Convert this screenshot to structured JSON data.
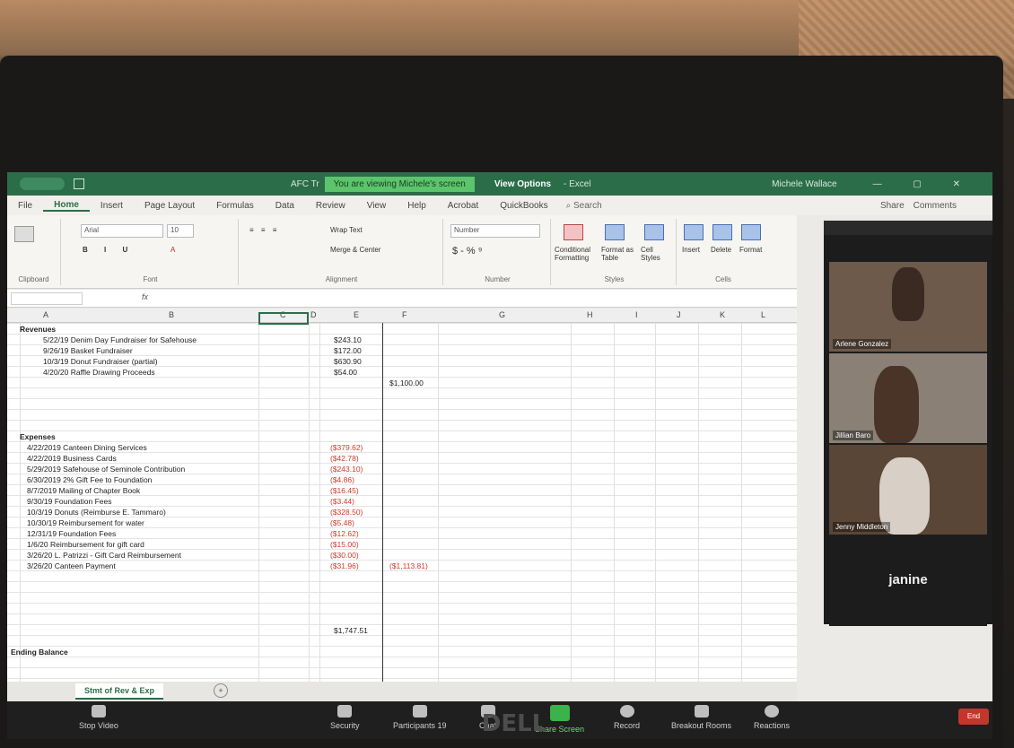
{
  "excel": {
    "doc_title": "AFC Tr",
    "viewing_banner": "You are viewing Michele's screen",
    "view_options": "View Options",
    "excel_suffix": "- Excel",
    "user_name": "Michele Wallace",
    "tabs": [
      "File",
      "Home",
      "Insert",
      "Page Layout",
      "Formulas",
      "Data",
      "Review",
      "View",
      "Help",
      "Acrobat",
      "QuickBooks"
    ],
    "search": "Search",
    "share": "Share",
    "comments": "Comments",
    "ribbon": {
      "font_name": "Arial",
      "font_size": "10",
      "wrap_text": "Wrap Text",
      "merge_center": "Merge & Center",
      "number_format": "Number",
      "conditional_formatting": "Conditional Formatting",
      "format_as_table": "Format as Table",
      "cell_styles": "Cell Styles",
      "insert": "Insert",
      "delete": "Delete",
      "format": "Format",
      "groups": [
        "Clipboard",
        "Font",
        "Alignment",
        "Number",
        "Styles",
        "Cells"
      ]
    },
    "columns": [
      "A",
      "B",
      "C",
      "D",
      "E",
      "F",
      "G",
      "H",
      "I",
      "J",
      "K",
      "L"
    ],
    "revenues_header": "Revenues",
    "revenues": [
      {
        "desc": "5/22/19 Denim Day Fundraiser for Safehouse",
        "amount": "$243.10"
      },
      {
        "desc": "9/26/19 Basket Fundraiser",
        "amount": "$172.00"
      },
      {
        "desc": "10/3/19 Donut Fundraiser (partial)",
        "amount": "$630.90"
      },
      {
        "desc": "4/20/20 Raffle Drawing Proceeds",
        "amount": "$54.00"
      }
    ],
    "revenue_total": "$1,100.00",
    "expenses_header": "Expenses",
    "expenses": [
      {
        "desc": "4/22/2019 Canteen Dining Services",
        "amount": "($379.62)"
      },
      {
        "desc": "4/22/2019 Business Cards",
        "amount": "($42.78)"
      },
      {
        "desc": "5/29/2019 Safehouse of Seminole Contribution",
        "amount": "($243.10)"
      },
      {
        "desc": "6/30/2019 2% Gift Fee to Foundation",
        "amount": "($4.86)"
      },
      {
        "desc": "8/7/2019 Mailing of Chapter Book",
        "amount": "($16.45)"
      },
      {
        "desc": "9/30/19 Foundation Fees",
        "amount": "($3.44)"
      },
      {
        "desc": "10/3/19 Donuts (Reimburse E. Tammaro)",
        "amount": "($328.50)"
      },
      {
        "desc": "10/30/19 Reimbursement for water",
        "amount": "($5.48)"
      },
      {
        "desc": "12/31/19 Foundation Fees",
        "amount": "($12.62)"
      },
      {
        "desc": "1/6/20 Reimbursement for gift card",
        "amount": "($15.00)"
      },
      {
        "desc": "3/26/20 L. Patrizzi - Gift Card Reimbursement",
        "amount": "($30.00)"
      },
      {
        "desc": "3/26/20 Canteen Payment",
        "amount": "($31.96)"
      }
    ],
    "expense_total": "($1,113.81)",
    "ending_balance_label": "Ending Balance",
    "ending_balance": "$1,747.51",
    "sheet_tab": "Stmt of Rev & Exp"
  },
  "zoom": {
    "participants": [
      {
        "name": "Arlene Gonzalez"
      },
      {
        "name": "Jillian Baro"
      },
      {
        "name": "Jenny Middleton"
      },
      {
        "name": "janine"
      }
    ],
    "toolbar": {
      "stop_video": "Stop Video",
      "security": "Security",
      "participants": "Participants",
      "participant_count": "19",
      "chat": "Chat",
      "share_screen": "Share Screen",
      "record": "Record",
      "breakout_rooms": "Breakout Rooms",
      "reactions": "Reactions",
      "end": "End"
    }
  },
  "monitor_brand": "DELL"
}
